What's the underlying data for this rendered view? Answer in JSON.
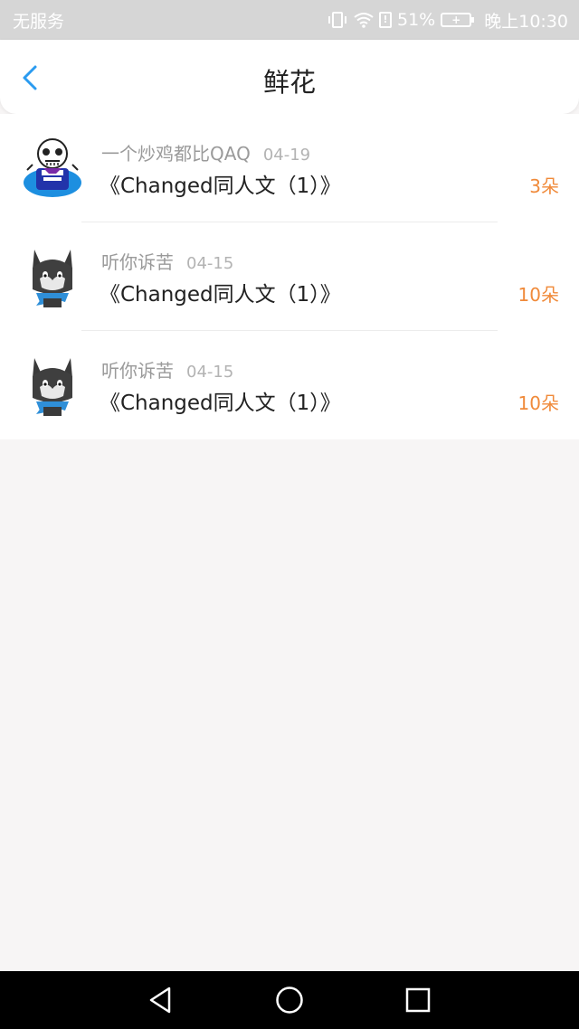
{
  "status_bar": {
    "carrier": "无服务",
    "battery_percent": "51%",
    "time": "晚上10:30",
    "alert_glyph": "!",
    "battery_glyph": "+",
    "icons": [
      "vibrate-icon",
      "wifi-icon",
      "alert-icon",
      "battery-icon"
    ]
  },
  "header": {
    "title": "鲜花",
    "back_icon": "chevron-left-icon",
    "accent_color": "#2a9bf0"
  },
  "list": {
    "items": [
      {
        "user": "一个炒鸡都比QAQ",
        "date": "04-19",
        "title": "《Changed同人文（1）》",
        "count": "3朵",
        "avatar_icon": "skeleton-avatar-icon"
      },
      {
        "user": "听你诉苦",
        "date": "04-15",
        "title": "《Changed同人文（1）》",
        "count": "10朵",
        "avatar_icon": "wolf-avatar-icon"
      },
      {
        "user": "听你诉苦",
        "date": "04-15",
        "title": "《Changed同人文（1）》",
        "count": "10朵",
        "avatar_icon": "wolf-avatar-icon"
      }
    ],
    "count_color": "#f08a3a"
  },
  "nav_bar": {
    "icons": [
      "triangle-back-icon",
      "circle-home-icon",
      "square-recent-icon"
    ]
  }
}
